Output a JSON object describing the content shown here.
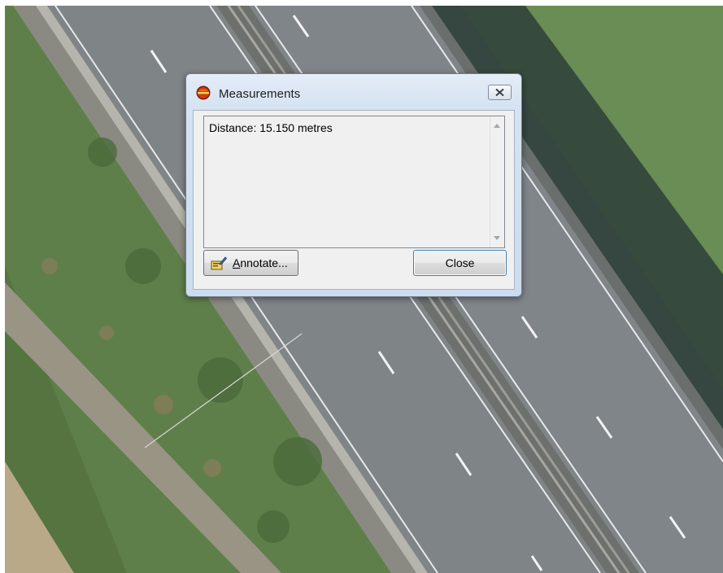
{
  "dialog": {
    "title": "Measurements",
    "result": "Distance: 15.150 metres",
    "annotate_label_mnemonic": "A",
    "annotate_label_rest": "nnotate...",
    "close_label": "Close"
  },
  "icons": {
    "app": "app-logo-icon",
    "close": "close-x-icon",
    "annotate": "annotate-icon"
  },
  "colors": {
    "grass": "#5f7f4a",
    "road": "#7f8487",
    "measure_line": "#d8d8d8"
  }
}
